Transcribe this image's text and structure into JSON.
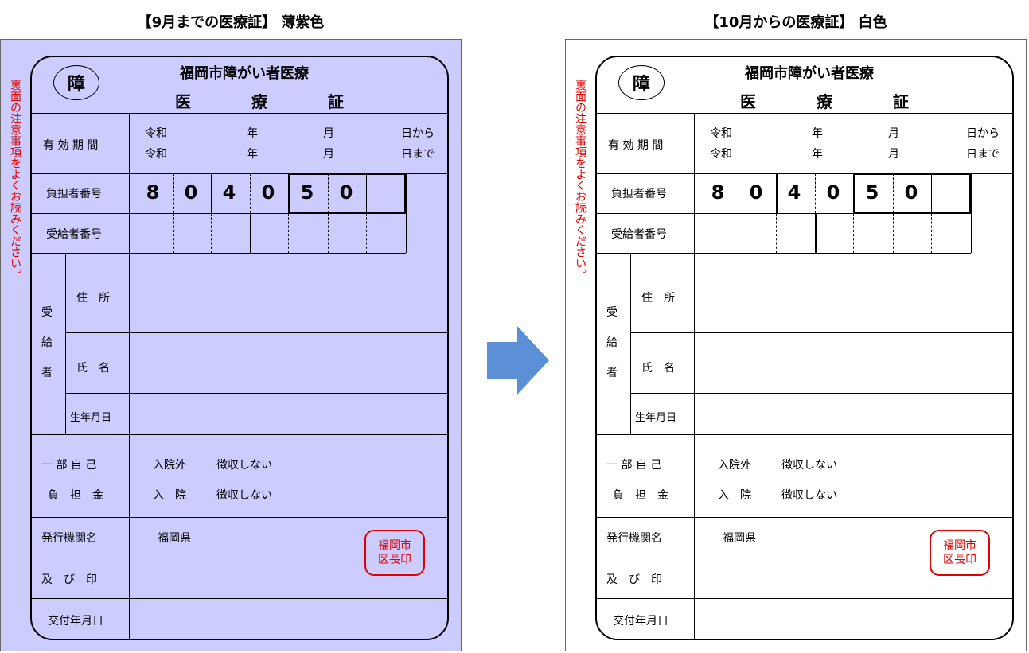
{
  "left": {
    "heading": "【9月までの医療証】 薄紫色",
    "bg": "#ccccff"
  },
  "right": {
    "heading": "【10月からの医療証】 白色",
    "bg": "#ffffff"
  },
  "card": {
    "side_note": "裏面の注意事項をよくお読みください。",
    "badge": "障",
    "title_line1": "福岡市障がい者医療",
    "title_line2": [
      "医",
      "療",
      "証"
    ],
    "validity_label": "有 効 期 間",
    "validity_from": [
      "令和",
      "年",
      "月",
      "日から"
    ],
    "validity_to": [
      "令和",
      "年",
      "月",
      "日まで"
    ],
    "payer_label": "負担者番号",
    "payer_digits": [
      "8",
      "0",
      "4",
      "0",
      "5",
      "0",
      ""
    ],
    "recipient_label": "受給者番号",
    "recipient_group": [
      "受",
      "給",
      "者"
    ],
    "address_label": "住　所",
    "name_label": "氏　名",
    "dob_label": "生年月日",
    "copay_label1": "一 部 自 己",
    "copay_label2": "負　担　金",
    "outpatient_label": "入院外",
    "outpatient_value": "徴収しない",
    "inpatient_label": "入　院",
    "inpatient_value": "徴収しない",
    "issuer_label1": "発行機関名",
    "issuer_label2": "及　び　印",
    "issuer_value": "福岡県",
    "seal_line1": "福岡市",
    "seal_line2": "区長印",
    "issue_date_label": "交付年月日"
  },
  "colors": {
    "arrow": "#5b8fd6",
    "seal": "#e00000",
    "note": "#e00000"
  },
  "icons": {
    "arrow": "right-arrow-icon"
  }
}
